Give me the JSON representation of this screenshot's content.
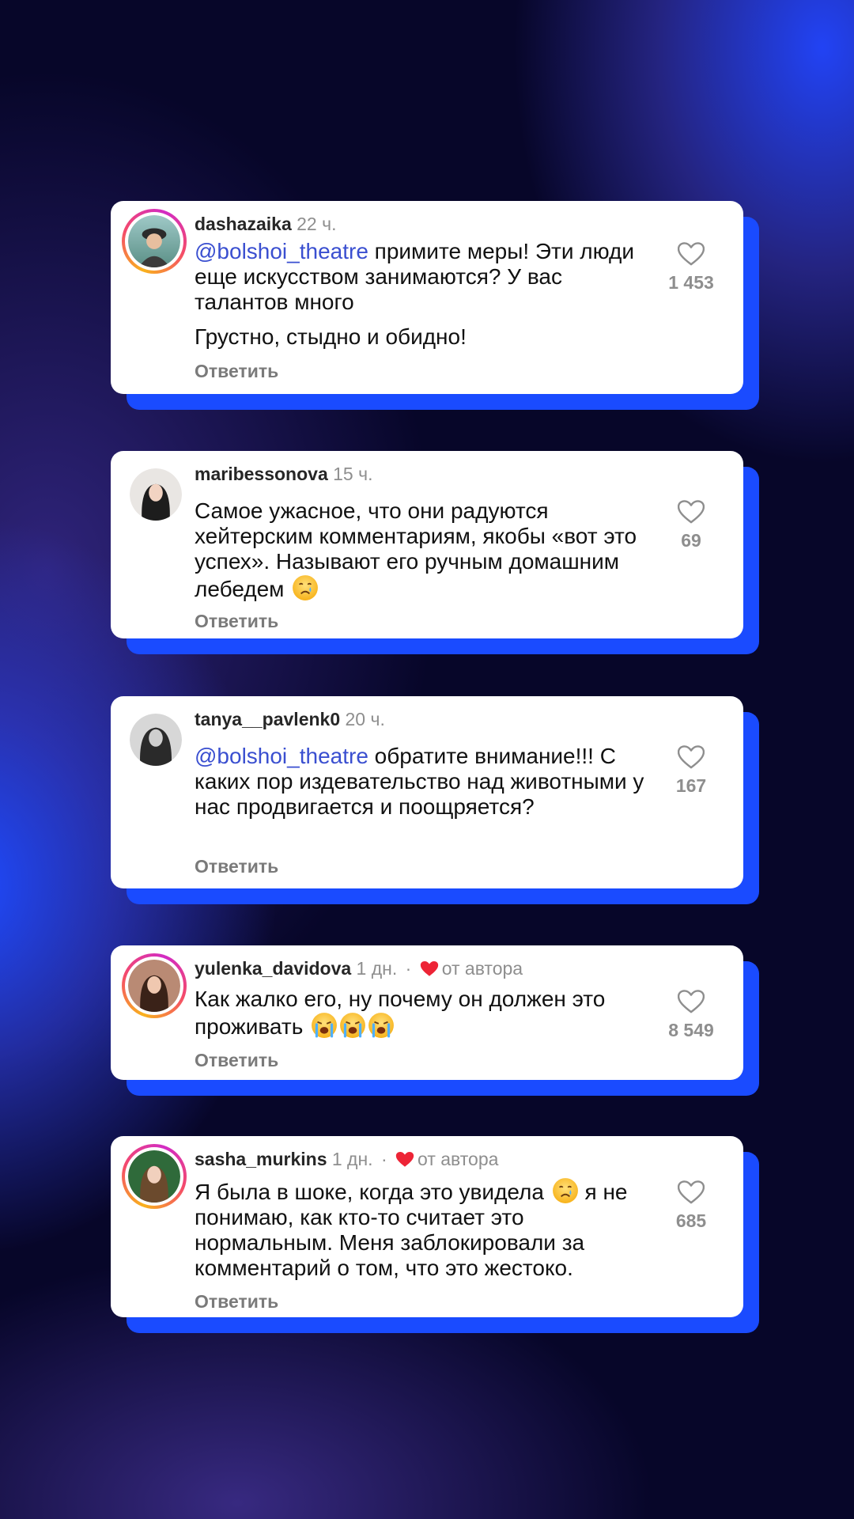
{
  "colors": {
    "background": "#070629",
    "accent_blue": "#1a4bff",
    "mention": "#3a4fd0",
    "author_heart": "#ed2436"
  },
  "comments": [
    {
      "username": "dashazaika",
      "time": "22 ч.",
      "mention": "@bolshoi_theatre",
      "text": " примите меры! Эти люди еще искусством занимаются? У вас талантов много",
      "text2": "Грустно, стыдно и обидно!",
      "likes": "1 453",
      "reply": "Ответить",
      "avatar_icon": "avatar-story-ring"
    },
    {
      "username": "maribessonova",
      "time": "15 ч.",
      "text": "Самое ужасное, что они радуются хейтерским комментариям, якобы «вот это успех». Называют его ручным домашним лебедем",
      "emoji": "crying-face-emoji",
      "likes": "69",
      "reply": "Ответить",
      "avatar_icon": "avatar"
    },
    {
      "username": "tanya__pavlenk0",
      "time": "20 ч.",
      "mention": "@bolshoi_theatre",
      "text": " обратите внимание!!! С каких пор издевательство над животными у нас продвигается и поощряется?",
      "likes": "167",
      "reply": "Ответить",
      "avatar_icon": "avatar"
    },
    {
      "username": "yulenka_davidova",
      "time": "1 дн.",
      "author_label": "от автора",
      "text": "Как жалко его, ну почему он должен это проживать",
      "emoji": "loudly-crying-face-emoji",
      "emoji_count": 3,
      "likes": "8 549",
      "reply": "Ответить",
      "avatar_icon": "avatar-story-ring"
    },
    {
      "username": "sasha_murkins",
      "time": "1 дн.",
      "author_label": "от автора",
      "text_before_emoji": "Я была в шоке, когда это увидела",
      "emoji": "crying-face-emoji",
      "text_after_emoji": " я не понимаю, как кто-то считает это нормальным. Меня заблокировали за комментарий о том, что это жестоко.",
      "likes": "685",
      "reply": "Ответить",
      "avatar_icon": "avatar-story-ring"
    }
  ]
}
